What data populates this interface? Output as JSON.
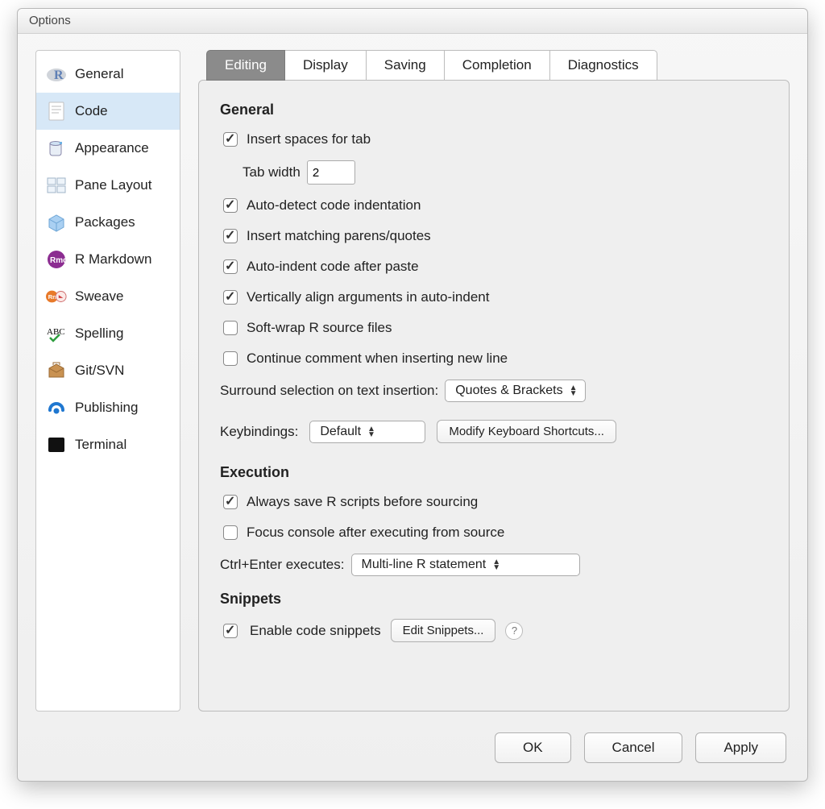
{
  "window": {
    "title": "Options"
  },
  "sidebar": {
    "items": [
      {
        "label": "General"
      },
      {
        "label": "Code"
      },
      {
        "label": "Appearance"
      },
      {
        "label": "Pane Layout"
      },
      {
        "label": "Packages"
      },
      {
        "label": "R Markdown"
      },
      {
        "label": "Sweave"
      },
      {
        "label": "Spelling"
      },
      {
        "label": "Git/SVN"
      },
      {
        "label": "Publishing"
      },
      {
        "label": "Terminal"
      }
    ],
    "active": "Code"
  },
  "tabs": {
    "items": [
      {
        "label": "Editing"
      },
      {
        "label": "Display"
      },
      {
        "label": "Saving"
      },
      {
        "label": "Completion"
      },
      {
        "label": "Diagnostics"
      }
    ],
    "active": "Editing"
  },
  "sections": {
    "general": {
      "title": "General",
      "insert_spaces": {
        "label": "Insert spaces for tab",
        "checked": true
      },
      "tab_width": {
        "label": "Tab width",
        "value": "2"
      },
      "auto_detect_indent": {
        "label": "Auto-detect code indentation",
        "checked": true
      },
      "match_parens": {
        "label": "Insert matching parens/quotes",
        "checked": true
      },
      "auto_indent_paste": {
        "label": "Auto-indent code after paste",
        "checked": true
      },
      "valign_args": {
        "label": "Vertically align arguments in auto-indent",
        "checked": true
      },
      "soft_wrap": {
        "label": "Soft-wrap R source files",
        "checked": false
      },
      "continue_comment": {
        "label": "Continue comment when inserting new line",
        "checked": false
      },
      "surround": {
        "label": "Surround selection on text insertion:",
        "value": "Quotes & Brackets"
      },
      "keybindings": {
        "label": "Keybindings:",
        "value": "Default",
        "modify_btn": "Modify Keyboard Shortcuts..."
      }
    },
    "execution": {
      "title": "Execution",
      "save_before_source": {
        "label": "Always save R scripts before sourcing",
        "checked": true
      },
      "focus_console": {
        "label": "Focus console after executing from source",
        "checked": false
      },
      "ctrl_enter": {
        "label": "Ctrl+Enter executes:",
        "value": "Multi-line R statement"
      }
    },
    "snippets": {
      "title": "Snippets",
      "enable": {
        "label": "Enable code snippets",
        "checked": true
      },
      "edit_btn": "Edit Snippets..."
    }
  },
  "footer": {
    "ok": "OK",
    "cancel": "Cancel",
    "apply": "Apply"
  }
}
